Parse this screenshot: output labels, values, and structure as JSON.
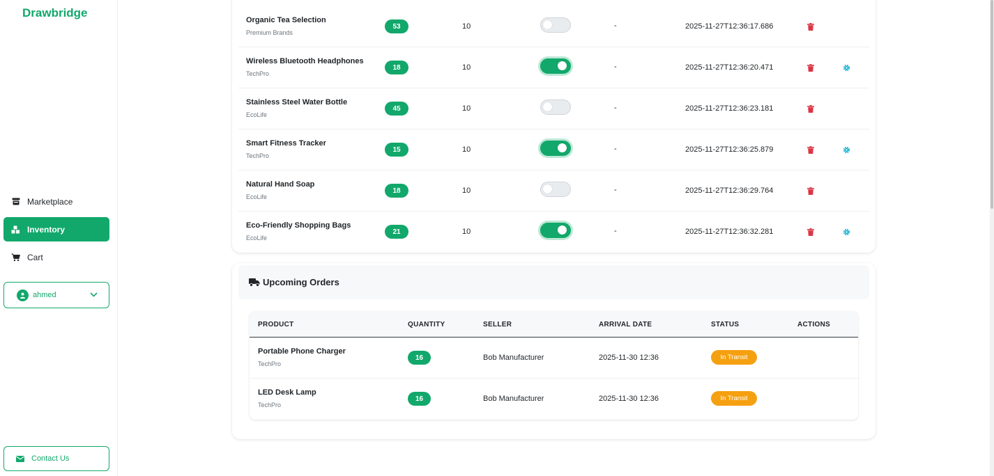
{
  "sidebar": {
    "brand": "Drawbridge",
    "items": [
      {
        "label": "Marketplace",
        "icon": "store-icon"
      },
      {
        "label": "Inventory",
        "icon": "boxes-icon",
        "active": true
      },
      {
        "label": "Cart",
        "icon": "cart-icon"
      }
    ],
    "user": {
      "name": "ahmed",
      "icon": "user-icon"
    },
    "contact": {
      "label": "Contact Us",
      "icon": "envelope-icon"
    }
  },
  "inventory": {
    "rows": [
      {
        "name": "Organic Tea Selection",
        "brand": "Premium Brands",
        "stock": "53",
        "threshold": "10",
        "auto": false,
        "extra": "-",
        "updated": "2025-11-27T12:36:17.686",
        "settings": false
      },
      {
        "name": "Wireless Bluetooth Headphones",
        "brand": "TechPro",
        "stock": "18",
        "threshold": "10",
        "auto": true,
        "extra": "-",
        "updated": "2025-11-27T12:36:20.471",
        "settings": true
      },
      {
        "name": "Stainless Steel Water Bottle",
        "brand": "EcoLife",
        "stock": "45",
        "threshold": "10",
        "auto": false,
        "extra": "-",
        "updated": "2025-11-27T12:36:23.181",
        "settings": false
      },
      {
        "name": "Smart Fitness Tracker",
        "brand": "TechPro",
        "stock": "15",
        "threshold": "10",
        "auto": true,
        "extra": "-",
        "updated": "2025-11-27T12:36:25.879",
        "settings": true
      },
      {
        "name": "Natural Hand Soap",
        "brand": "EcoLife",
        "stock": "18",
        "threshold": "10",
        "auto": false,
        "extra": "-",
        "updated": "2025-11-27T12:36:29.764",
        "settings": false
      },
      {
        "name": "Eco-Friendly Shopping Bags",
        "brand": "EcoLife",
        "stock": "21",
        "threshold": "10",
        "auto": true,
        "extra": "-",
        "updated": "2025-11-27T12:36:32.281",
        "settings": true
      }
    ]
  },
  "orders": {
    "title": "Upcoming Orders",
    "title_icon": "truck-icon",
    "headers": {
      "product": "PRODUCT",
      "quantity": "QUANTITY",
      "seller": "SELLER",
      "arrival": "ARRIVAL DATE",
      "status": "STATUS",
      "actions": "ACTIONS"
    },
    "rows": [
      {
        "name": "Portable Phone Charger",
        "brand": "TechPro",
        "quantity": "16",
        "seller": "Bob Manufacturer",
        "arrival": "2025-11-30 12:36",
        "status": "In Transit"
      },
      {
        "name": "LED Desk Lamp",
        "brand": "TechPro",
        "quantity": "16",
        "seller": "Bob Manufacturer",
        "arrival": "2025-11-30 12:36",
        "status": "In Transit"
      }
    ]
  },
  "colors": {
    "accent": "#12a86b",
    "danger": "#dc3545",
    "info": "#17b3d6",
    "warning": "#f5a010"
  }
}
